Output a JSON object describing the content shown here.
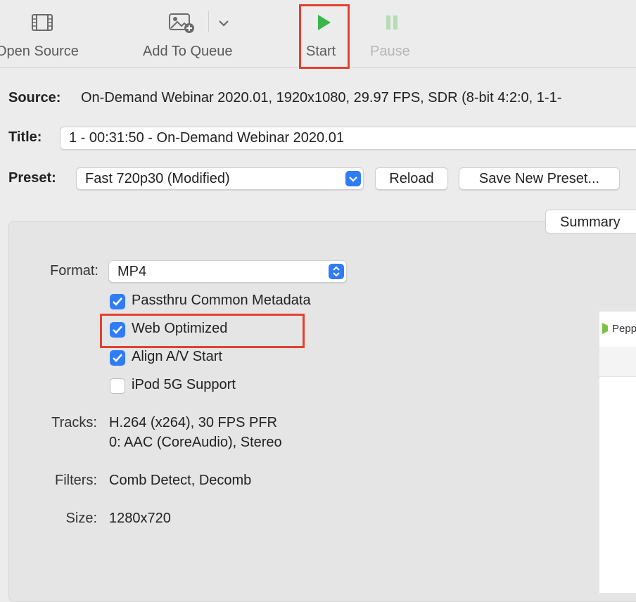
{
  "toolbar": {
    "open_source": "Open Source",
    "add_to_queue": "Add To Queue",
    "start": "Start",
    "pause": "Pause"
  },
  "source": {
    "label": "Source:",
    "value": "On-Demand Webinar 2020.01, 1920x1080, 29.97 FPS, SDR (8-bit 4:2:0, 1-1-"
  },
  "title": {
    "label": "Title:",
    "value": "1 - 00:31:50 - On-Demand Webinar 2020.01"
  },
  "preset": {
    "label": "Preset:",
    "value": "Fast 720p30 (Modified)",
    "reload": "Reload",
    "save_new": "Save New Preset..."
  },
  "tabs": {
    "summary": "Summary"
  },
  "summary": {
    "format_label": "Format:",
    "format_value": "MP4",
    "options": [
      {
        "label": "Passthru Common Metadata",
        "checked": true
      },
      {
        "label": "Web Optimized",
        "checked": true
      },
      {
        "label": "Align A/V Start",
        "checked": true
      },
      {
        "label": "iPod 5G Support",
        "checked": false
      }
    ],
    "tracks_label": "Tracks:",
    "tracks_line1": "H.264 (x264), 30 FPS PFR",
    "tracks_line2": "0: AAC (CoreAudio), Stereo",
    "filters_label": "Filters:",
    "filters_value": "Comb Detect, Decomb",
    "size_label": "Size:",
    "size_value": "1280x720"
  },
  "preview": {
    "text": "Pepp"
  },
  "colors": {
    "highlight": "#e4412f",
    "accent": "#2f7cf6",
    "start_green": "#3cb54a",
    "pause_disabled": "#b6dcb6"
  }
}
